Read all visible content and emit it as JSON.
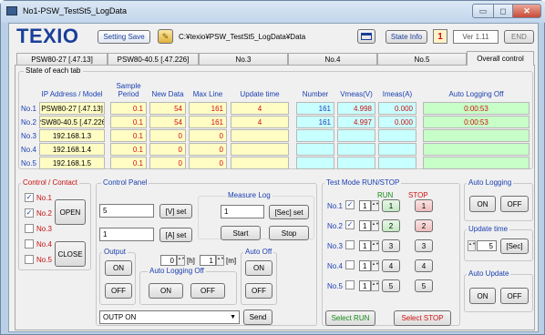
{
  "window": {
    "title": "No1-PSW_TestSt5_LogData",
    "min_glyph": "▭",
    "max_glyph": "◻",
    "close_glyph": "✕"
  },
  "header": {
    "logo": "TEXIO",
    "setting_save": "Setting Save",
    "path": "C:¥texio¥PSW_TestSt5_LogData¥Data",
    "state_info": "State Info",
    "state_number": "1",
    "version": "Ver 1.11",
    "end": "END"
  },
  "tabs": [
    "PSW80-27  [.47.13]",
    "PSW80-40.5  [.47.226]",
    "No.3",
    "No.4",
    "No.5",
    "Overall control"
  ],
  "state_table": {
    "title": "State of each tab",
    "headers": [
      "IP Address / Model",
      "Sample Period",
      "New Data",
      "Max Line",
      "Update time",
      "Number",
      "Vmeas(V)",
      "Imeas(A)",
      "Auto Logging Off"
    ],
    "rows": [
      {
        "label": "No.1",
        "ip": "PSW80-27  [.47.13]",
        "period": "0.1",
        "newdata": "54",
        "maxline": "161",
        "update": "4",
        "number": "161",
        "vmeas": "4.998",
        "imeas": "0.000",
        "autooff": "0:00:53"
      },
      {
        "label": "No.2",
        "ip": "PSW80-40.5  [.47.226]",
        "period": "0.1",
        "newdata": "54",
        "maxline": "161",
        "update": "4",
        "number": "161",
        "vmeas": "4.997",
        "imeas": "0.000",
        "autooff": "0:00:53"
      },
      {
        "label": "No.3",
        "ip": "192.168.1.3",
        "period": "0.1",
        "newdata": "0",
        "maxline": "0",
        "update": "",
        "number": "",
        "vmeas": "",
        "imeas": "",
        "autooff": ""
      },
      {
        "label": "No.4",
        "ip": "192.168.1.4",
        "period": "0.1",
        "newdata": "0",
        "maxline": "0",
        "update": "",
        "number": "",
        "vmeas": "",
        "imeas": "",
        "autooff": ""
      },
      {
        "label": "No.5",
        "ip": "192.168.1.5",
        "period": "0.1",
        "newdata": "0",
        "maxline": "0",
        "update": "",
        "number": "",
        "vmeas": "",
        "imeas": "",
        "autooff": ""
      }
    ]
  },
  "control_contact": {
    "title": "Control / Contact",
    "items": [
      {
        "label": "No.1",
        "checked": true
      },
      {
        "label": "No.2",
        "checked": true
      },
      {
        "label": "No.3",
        "checked": false
      },
      {
        "label": "No.4",
        "checked": false
      },
      {
        "label": "No.5",
        "checked": false
      }
    ],
    "open": "OPEN",
    "close": "CLOSE"
  },
  "control_panel": {
    "title": "Control Panel",
    "v_value": "5",
    "v_set": "[V] set",
    "a_value": "1",
    "a_set": "[A] set",
    "measure_log": "Measure Log",
    "sec_value": "1",
    "sec_set": "[Sec] set",
    "start": "Start",
    "stop": "Stop",
    "output": "Output",
    "output_on": "ON",
    "output_off": "OFF",
    "hours": "0",
    "h_unit": "[h]",
    "minutes": "1",
    "m_unit": "[m]",
    "auto_logging_off": "Auto Logging Off",
    "alo_on": "ON",
    "alo_off": "OFF",
    "auto_off": "Auto Off",
    "ao_on": "ON",
    "ao_off": "OFF",
    "command": "OUTP ON",
    "send": "Send"
  },
  "test_mode": {
    "title": "Test Mode RUN/STOP",
    "run_label": "RUN",
    "stop_label": "STOP",
    "run_color": "#1a8a1a",
    "stop_color": "#d01010",
    "rows": [
      {
        "label": "No.1",
        "checked": true,
        "value": "1",
        "run": "1",
        "stop": "1"
      },
      {
        "label": "No.2",
        "checked": true,
        "value": "1",
        "run": "2",
        "stop": "2"
      },
      {
        "label": "No.3",
        "checked": false,
        "value": "1",
        "run": "3",
        "stop": "3"
      },
      {
        "label": "No.4",
        "checked": false,
        "value": "1",
        "run": "4",
        "stop": "4"
      },
      {
        "label": "No.5",
        "checked": false,
        "value": "1",
        "run": "5",
        "stop": "5"
      }
    ],
    "select_run": "Select RUN",
    "select_stop": "Select STOP"
  },
  "auto_logging": {
    "title": "Auto Logging",
    "on": "ON",
    "off": "OFF"
  },
  "update_time": {
    "title": "Update time",
    "value": "5",
    "unit": "[Sec]"
  },
  "auto_update": {
    "title": "Auto Update",
    "on": "ON",
    "off": "OFF"
  },
  "colors": {
    "yellow": "#fffdc4",
    "cyan": "#c8ffff",
    "green": "#c8ffc8",
    "red_text": "#d01010",
    "blue_label": "#1a3fb0",
    "contact_label": "#c81010"
  }
}
